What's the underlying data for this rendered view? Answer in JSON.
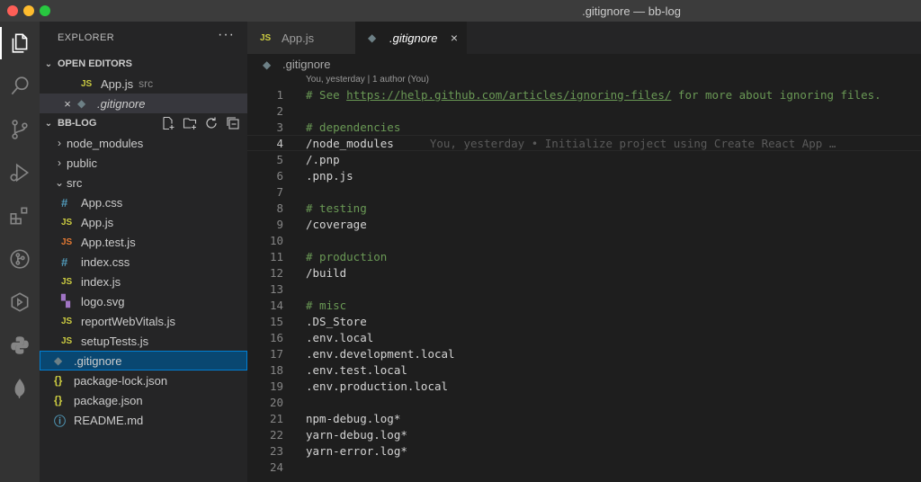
{
  "window": {
    "title": ".gitignore — bb-log"
  },
  "explorer": {
    "header": "EXPLORER",
    "more": "···",
    "open_editors_label": "OPEN EDITORS",
    "open_editors": [
      {
        "name": "App.js",
        "desc": "src",
        "icon": "JS"
      },
      {
        "name": ".gitignore",
        "close": "×",
        "icon": "◆"
      }
    ],
    "project_label": "BB-LOG",
    "tree": [
      {
        "name": "node_modules",
        "type": "folder"
      },
      {
        "name": "public",
        "type": "folder"
      },
      {
        "name": "src",
        "type": "folder-open"
      },
      {
        "name": "App.css",
        "icon": "#"
      },
      {
        "name": "App.js",
        "icon": "JS"
      },
      {
        "name": "App.test.js",
        "icon": "JS"
      },
      {
        "name": "index.css",
        "icon": "#"
      },
      {
        "name": "index.js",
        "icon": "JS"
      },
      {
        "name": "logo.svg",
        "icon": "▚"
      },
      {
        "name": "reportWebVitals.js",
        "icon": "JS"
      },
      {
        "name": "setupTests.js",
        "icon": "JS"
      },
      {
        "name": ".gitignore",
        "icon": "◆"
      },
      {
        "name": "package-lock.json",
        "icon": "{}"
      },
      {
        "name": "package.json",
        "icon": "{}"
      },
      {
        "name": "README.md",
        "icon": "ⓘ"
      }
    ]
  },
  "tabs": [
    {
      "label": "App.js",
      "icon": "JS"
    },
    {
      "label": ".gitignore",
      "icon": "◆",
      "close": "×"
    }
  ],
  "breadcrumb": {
    "icon": "◆",
    "file": ".gitignore"
  },
  "blame_header": "You, yesterday | 1 author (You)",
  "code": {
    "line_numbers": [
      "1",
      "2",
      "3",
      "4",
      "5",
      "6",
      "7",
      "8",
      "9",
      "10",
      "11",
      "12",
      "13",
      "14",
      "15",
      "16",
      "17",
      "18",
      "19",
      "20",
      "21",
      "22",
      "23",
      "24"
    ],
    "line1_prefix": "# See ",
    "line1_link": "https://help.github.com/articles/ignoring-files/",
    "line1_suffix": " for more about ignoring files.",
    "line3": "# dependencies",
    "line4": "/node_modules",
    "line4_blame": "You, yesterday • Initialize project using Create React App …",
    "line5": "/.pnp",
    "line6": ".pnp.js",
    "line8": "# testing",
    "line9": "/coverage",
    "line11": "# production",
    "line12": "/build",
    "line14": "# misc",
    "line15": ".DS_Store",
    "line16": ".env.local",
    "line17": ".env.development.local",
    "line18": ".env.test.local",
    "line19": ".env.production.local",
    "line21": "npm-debug.log*",
    "line22": "yarn-debug.log*",
    "line23": "yarn-error.log*"
  },
  "colors": {
    "editor_bg": "#1e1e1e",
    "sidebar_bg": "#252526",
    "activity_bg": "#333333",
    "comment": "#6a9955",
    "selection": "#094771"
  },
  "icons": {
    "activity": [
      "files-icon",
      "search-icon",
      "source-control-icon",
      "run-debug-icon",
      "extensions-icon",
      "git-graph-icon",
      "remote-explorer-icon",
      "python-icon",
      "mongodb-leaf-icon"
    ]
  }
}
